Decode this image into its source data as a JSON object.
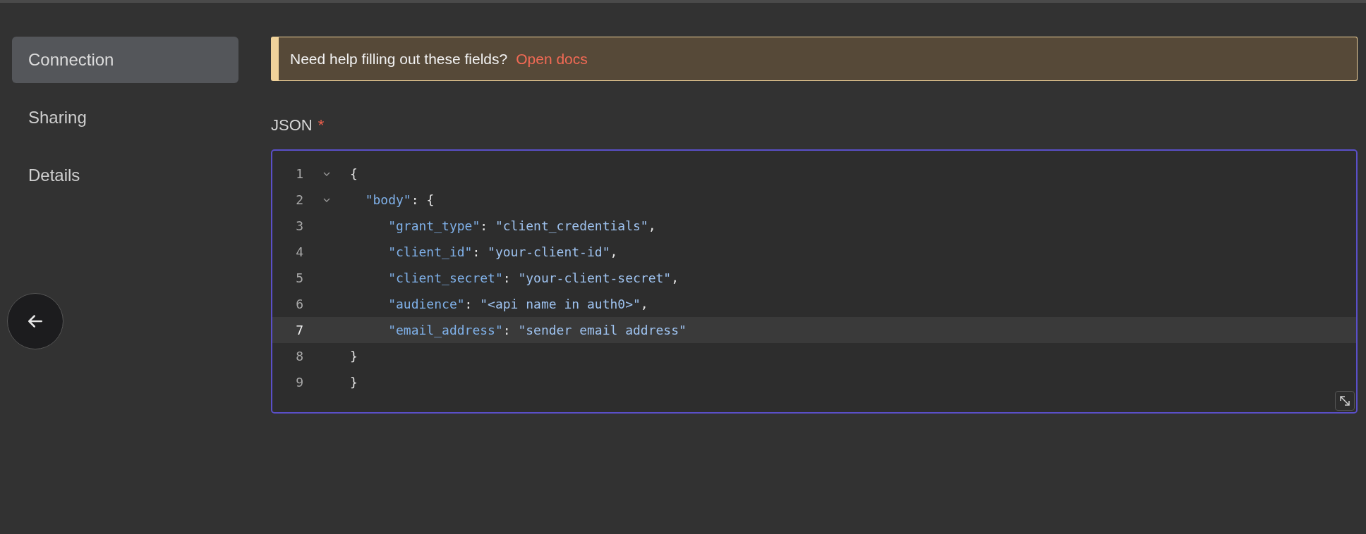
{
  "sidebar": {
    "items": [
      {
        "label": "Connection",
        "selected": true
      },
      {
        "label": "Sharing",
        "selected": false
      },
      {
        "label": "Details",
        "selected": false
      }
    ]
  },
  "banner": {
    "text": "Need help filling out these fields?",
    "link": "Open docs"
  },
  "field": {
    "label": "JSON",
    "required": "*"
  },
  "editor": {
    "lines": [
      {
        "number": "1",
        "fold": true,
        "active": false,
        "tokens": [
          {
            "kind": "punct",
            "text": "{"
          }
        ]
      },
      {
        "number": "2",
        "fold": true,
        "active": false,
        "tokens": [
          {
            "kind": "key",
            "text": "  \"body\""
          },
          {
            "kind": "punct",
            "text": ": {"
          }
        ]
      },
      {
        "number": "3",
        "fold": false,
        "active": false,
        "tokens": [
          {
            "kind": "key",
            "text": "     \"grant_type\""
          },
          {
            "kind": "punct",
            "text": ": "
          },
          {
            "kind": "string",
            "text": "\"client_credentials\""
          },
          {
            "kind": "punct",
            "text": ","
          }
        ]
      },
      {
        "number": "4",
        "fold": false,
        "active": false,
        "tokens": [
          {
            "kind": "key",
            "text": "     \"client_id\""
          },
          {
            "kind": "punct",
            "text": ": "
          },
          {
            "kind": "string",
            "text": "\"your-client-id\""
          },
          {
            "kind": "punct",
            "text": ","
          }
        ]
      },
      {
        "number": "5",
        "fold": false,
        "active": false,
        "tokens": [
          {
            "kind": "key",
            "text": "     \"client_secret\""
          },
          {
            "kind": "punct",
            "text": ": "
          },
          {
            "kind": "string",
            "text": "\"your-client-secret\""
          },
          {
            "kind": "punct",
            "text": ","
          }
        ]
      },
      {
        "number": "6",
        "fold": false,
        "active": false,
        "tokens": [
          {
            "kind": "key",
            "text": "     \"audience\""
          },
          {
            "kind": "punct",
            "text": ": "
          },
          {
            "kind": "string",
            "text": "\"<api name in auth0>\""
          },
          {
            "kind": "punct",
            "text": ","
          }
        ]
      },
      {
        "number": "7",
        "fold": false,
        "active": true,
        "tokens": [
          {
            "kind": "key",
            "text": "     \"email_address\""
          },
          {
            "kind": "punct",
            "text": ": "
          },
          {
            "kind": "string",
            "text": "\"sender email address\""
          }
        ]
      },
      {
        "number": "8",
        "fold": false,
        "active": false,
        "tokens": [
          {
            "kind": "punct",
            "text": "}"
          }
        ]
      },
      {
        "number": "9",
        "fold": false,
        "active": false,
        "tokens": [
          {
            "kind": "punct",
            "text": "}"
          }
        ]
      }
    ]
  }
}
